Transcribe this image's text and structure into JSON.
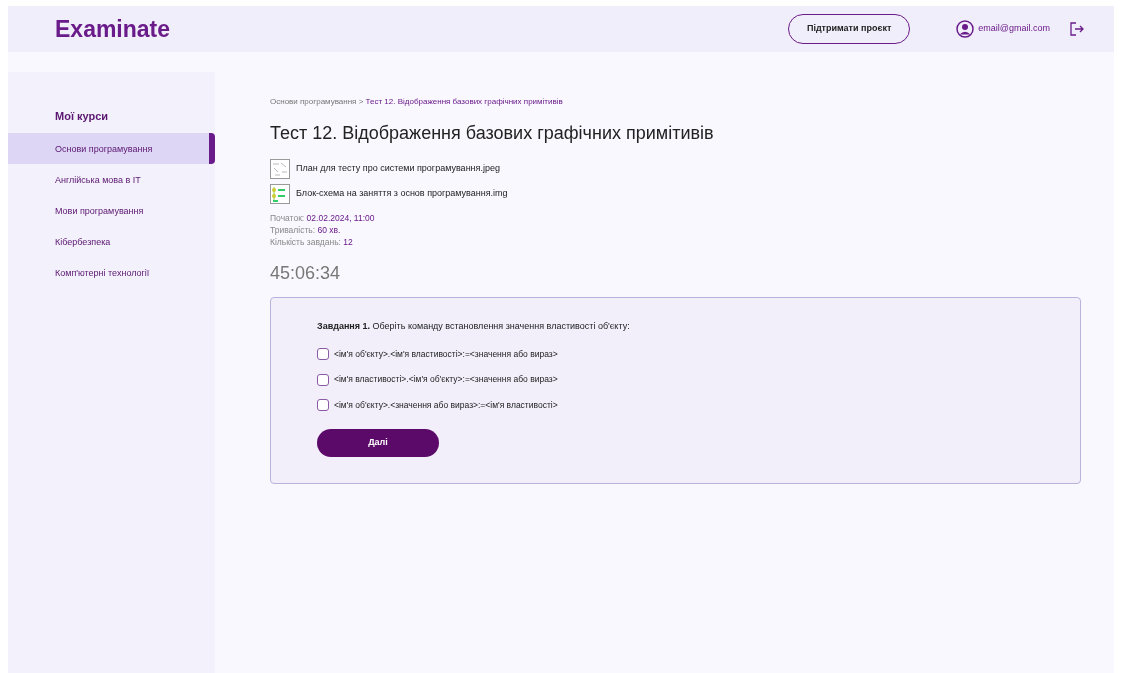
{
  "header": {
    "logo": "Examinate",
    "support_button": "Підтримати проєкт",
    "email": "email@gmail.com"
  },
  "sidebar": {
    "title": "Мої курси",
    "items": [
      {
        "label": "Основи програмування",
        "selected": true
      },
      {
        "label": "Англійська мова в IT",
        "selected": false
      },
      {
        "label": "Мови програмування",
        "selected": false
      },
      {
        "label": "Кібербезпека",
        "selected": false
      },
      {
        "label": "Комп'ютерні технології",
        "selected": false
      }
    ]
  },
  "breadcrumb": [
    {
      "label": "Основи програмування",
      "current": false
    },
    {
      "label": ">",
      "current": false
    },
    {
      "label": "Тест 12. Відображення базових графічних примітивів",
      "current": true
    }
  ],
  "title": "Тест 12. Відображення базових графічних примітивів",
  "attachments": [
    {
      "kind": "sketch",
      "name": "План для тесту про системи програмування.jpeg"
    },
    {
      "kind": "flowchart",
      "name": "Блок-схема на заняття з основ програмування.img"
    }
  ],
  "info": [
    {
      "label": "Початок:",
      "value": "02.02.2024, 11:00"
    },
    {
      "label": "Тривалість:",
      "value": "60 хв."
    },
    {
      "label": "Кількість завдань:",
      "value": "12"
    }
  ],
  "timer": "45:06:34",
  "task": {
    "question": "**Завдання 1.** Оберіть команду встановлення значення властивості об'єкту:",
    "options": [
      {
        "label": "<ім'я об'єкту>.<ім'я властивості>:=<значення або вираз>",
        "checked": false
      },
      {
        "label": "<ім'я властивості>.<ім'я об'єкту>:=<значення або вираз>",
        "checked": false
      },
      {
        "label": "<ім'я об'єкту>.<значення або вираз>:=<ім'я властивості>",
        "checked": false
      }
    ],
    "next_button": "Далі"
  }
}
